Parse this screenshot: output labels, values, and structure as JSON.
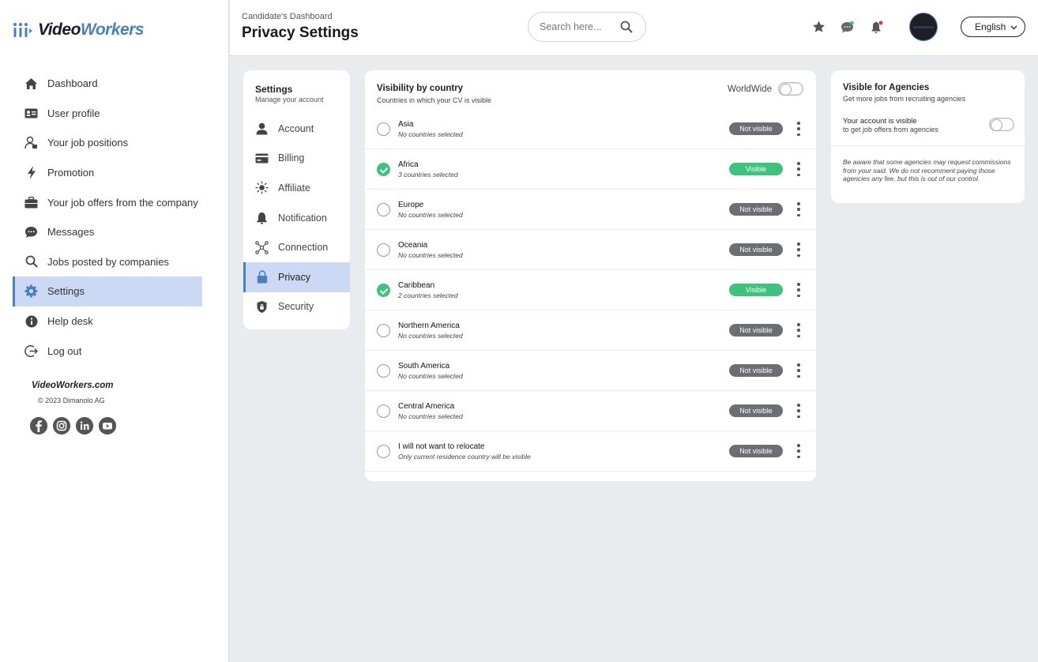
{
  "app": {
    "brand_v": "Video",
    "brand_w": "Workers"
  },
  "sidebar": {
    "items": [
      {
        "label": "Dashboard",
        "icon": "home-icon"
      },
      {
        "label": "User profile",
        "icon": "id-card-icon"
      },
      {
        "label": "Your job positions",
        "icon": "user-tie-icon"
      },
      {
        "label": "Promotion",
        "icon": "bolt-icon"
      },
      {
        "label": "Your job offers from the company",
        "icon": "briefcase-icon"
      },
      {
        "label": "Messages",
        "icon": "chat-icon"
      },
      {
        "label": "Jobs posted by companies",
        "icon": "search-icon"
      },
      {
        "label": "Settings",
        "icon": "gear-icon",
        "active": true
      },
      {
        "label": "Help desk",
        "icon": "info-icon"
      },
      {
        "label": "Log out",
        "icon": "logout-icon"
      }
    ],
    "footer_brand": "VideoWorkers.com",
    "copyright": "© 2023 Dimanolo AG",
    "socials": [
      "facebook-icon",
      "instagram-icon",
      "linkedin-icon",
      "youtube-icon"
    ]
  },
  "header": {
    "breadcrumb": "Candidate's Dashboard",
    "title": "Privacy Settings",
    "search_placeholder": "Search here...",
    "language": "English"
  },
  "settings_menu": {
    "title": "Settings",
    "subtitle": "Manage your account",
    "items": [
      {
        "label": "Account",
        "icon": "user-icon"
      },
      {
        "label": "Billing",
        "icon": "credit-card-icon"
      },
      {
        "label": "Affiliate",
        "icon": "affiliate-icon"
      },
      {
        "label": "Notification",
        "icon": "bell-icon"
      },
      {
        "label": "Connection",
        "icon": "network-icon"
      },
      {
        "label": "Privacy",
        "icon": "lock-icon",
        "active": true
      },
      {
        "label": "Security",
        "icon": "shield-icon"
      }
    ]
  },
  "visibility": {
    "title": "Visibility by country",
    "subtitle": "Countries in which your CV is visible",
    "worldwide_label": "WorldWide",
    "worldwide_on": false,
    "regions": [
      {
        "name": "Asia",
        "detail": "No countries selected",
        "checked": false,
        "status": "Not visible"
      },
      {
        "name": "Africa",
        "detail": "3 countries selected",
        "checked": true,
        "status": "Visible"
      },
      {
        "name": "Europe",
        "detail": "No countries selected",
        "checked": false,
        "status": "Not visible"
      },
      {
        "name": "Oceania",
        "detail": "No countries selected",
        "checked": false,
        "status": "Not visible"
      },
      {
        "name": "Caribbean",
        "detail": "2 countries selected",
        "checked": true,
        "status": "Visible"
      },
      {
        "name": "Northern America",
        "detail": "No countries selected",
        "checked": false,
        "status": "Not visible"
      },
      {
        "name": "South America",
        "detail": "No countries selected",
        "checked": false,
        "status": "Not visible"
      },
      {
        "name": "Central America",
        "detail": "No countries selected",
        "checked": false,
        "status": "Not visible"
      },
      {
        "name": "I will not want to relocate",
        "detail": "Only current residence country will be visible",
        "checked": false,
        "status": "Not visible"
      }
    ]
  },
  "agencies": {
    "title": "Visible for Agencies",
    "subtitle": "Get more jobs from recruiting agencies",
    "toggle_label": "Your account is visible",
    "toggle_sub": "to get job offers from agencies",
    "toggle_on": false,
    "note": "Be aware that some agencies may request commissions from your said. We do not recomment paying those agencies any fee, but this is out of our control."
  },
  "colors": {
    "accent": "#4a7fc1",
    "active_bg": "#ccd9f5",
    "visible_green": "#3cc47c",
    "not_visible_gray": "#6b6e72"
  }
}
